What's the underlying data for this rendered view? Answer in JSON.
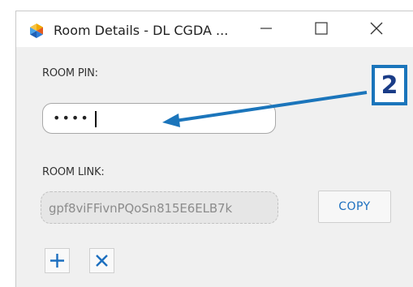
{
  "window": {
    "title": "Room Details - DL CGDA ...",
    "icon": "app-logo-icon",
    "controls": [
      "minimize-icon",
      "maximize-icon",
      "close-icon"
    ]
  },
  "room_pin": {
    "label": "ROOM PIN:",
    "value": "••••"
  },
  "room_link": {
    "label": "ROOM LINK:",
    "value": "gpf8viFFivnPQoSn815E6ELB7k",
    "copy_label": "COPY"
  },
  "actions": [
    "add-icon",
    "remove-icon"
  ],
  "annotation": {
    "step": "2"
  },
  "colors": {
    "accent": "#1c6fbf",
    "annotation_blue": "#1b75bb",
    "badge_text": "#1a3c87"
  }
}
